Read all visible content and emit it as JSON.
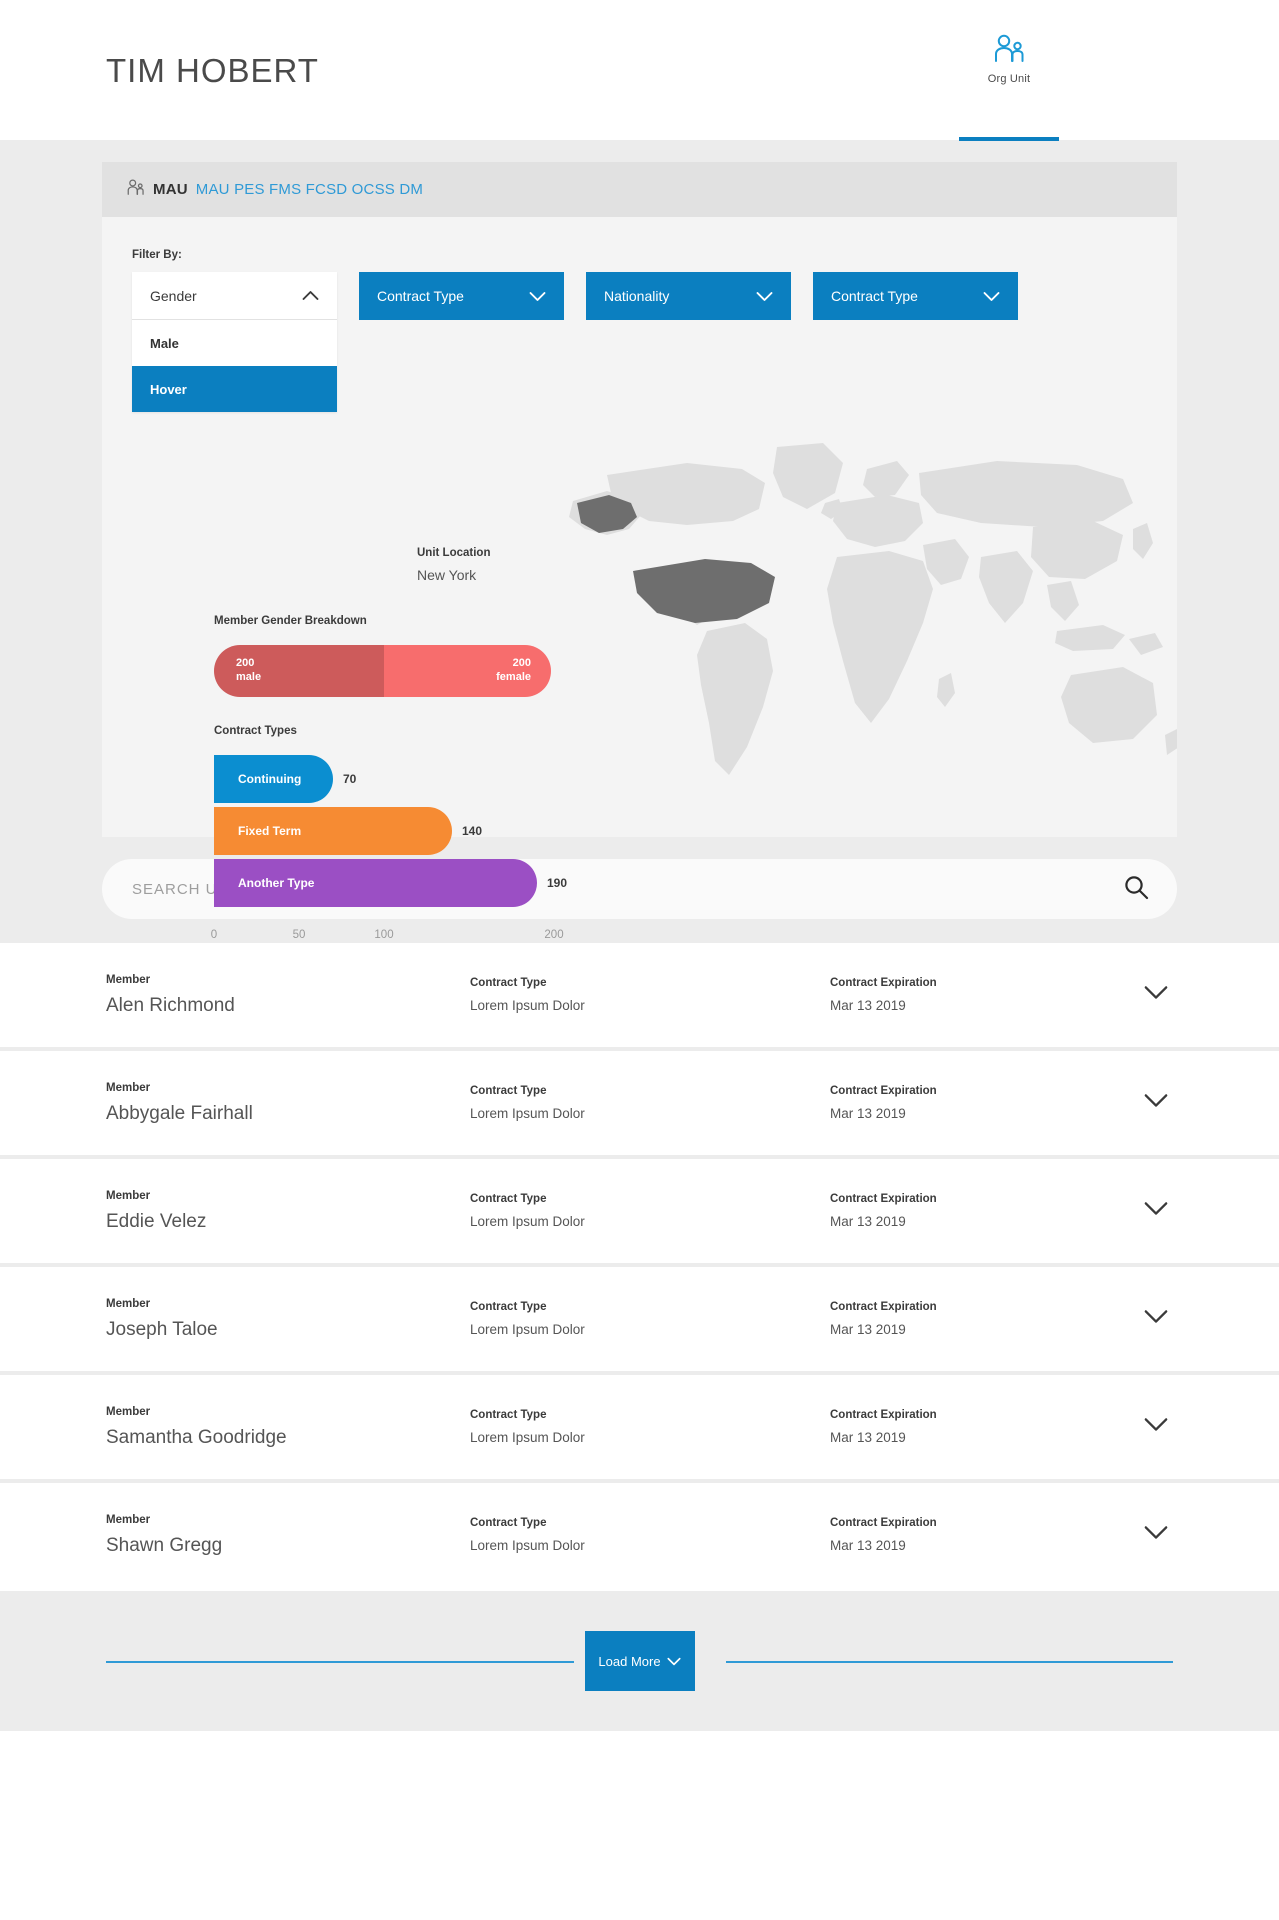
{
  "header": {
    "title": "TIM HOBERT",
    "tab": {
      "label": "Org Unit",
      "icon": "people-icon"
    }
  },
  "breadcrumb": {
    "icon": "people-icon",
    "root": "MAU",
    "path": "MAU PES FMS FCSD OCSS DM"
  },
  "filters": {
    "label": "Filter By:",
    "gender_dropdown": {
      "name": "Gender",
      "state": "open",
      "chevron": "chevron-up-icon",
      "options": [
        {
          "label": "Male",
          "hovered": false
        },
        {
          "label": "Hover",
          "hovered": true
        }
      ]
    },
    "dropdowns": [
      {
        "label": "Contract Type",
        "chevron": "chevron-down-icon"
      },
      {
        "label": "Nationality",
        "chevron": "chevron-down-icon"
      },
      {
        "label": "Contract Type",
        "chevron": "chevron-down-icon"
      }
    ]
  },
  "unit_location": {
    "label": "Unit Location",
    "value": "New York"
  },
  "gender_breakdown": {
    "title": "Member Gender Breakdown",
    "segments": [
      {
        "count": "200",
        "label": "male",
        "color": "#cd5b5b"
      },
      {
        "count": "200",
        "label": "female",
        "color": "#f76d6d"
      }
    ]
  },
  "contract_types": {
    "title": "Contract Types"
  },
  "chart_data": {
    "type": "bar",
    "orientation": "horizontal",
    "title": "Contract Types",
    "categories": [
      "Continuing",
      "Fixed Term",
      "Another Type"
    ],
    "values": [
      70,
      140,
      190
    ],
    "colors": [
      "#0b8ed0",
      "#f68b33",
      "#9b4fc4"
    ],
    "xlabel": "",
    "ylabel": "",
    "xlim": [
      0,
      200
    ],
    "ticks": [
      "0",
      "50",
      "100",
      "200"
    ],
    "grid": false,
    "legend": false
  },
  "map": {
    "name": "world-map",
    "highlighted_country": "United States",
    "base_color": "#dedede",
    "highlight_color": "#6e6e6e"
  },
  "search": {
    "placeholder": "SEARCH UNIT MEMBERS",
    "value": "",
    "icon": "search-icon"
  },
  "members_table": {
    "columns": {
      "member": "Member",
      "contract_type": "Contract Type",
      "contract_expiration": "Contract Expiration"
    },
    "rows": [
      {
        "member": "Alen Richmond",
        "contract_type": "Lorem Ipsum Dolor",
        "contract_expiration": "Mar 13 2019"
      },
      {
        "member": "Abbygale Fairhall",
        "contract_type": "Lorem Ipsum Dolor",
        "contract_expiration": "Mar 13 2019"
      },
      {
        "member": "Eddie Velez",
        "contract_type": "Lorem Ipsum Dolor",
        "contract_expiration": "Mar 13 2019"
      },
      {
        "member": "Joseph Taloe",
        "contract_type": "Lorem Ipsum Dolor",
        "contract_expiration": "Mar 13 2019"
      },
      {
        "member": "Samantha Goodridge",
        "contract_type": "Lorem Ipsum Dolor",
        "contract_expiration": "Mar 13 2019"
      },
      {
        "member": "Shawn Gregg",
        "contract_type": "Lorem Ipsum Dolor",
        "contract_expiration": "Mar 13 2019"
      }
    ]
  },
  "footer": {
    "load_more": "Load More",
    "chevron": "chevron-down-icon"
  },
  "colors": {
    "accent": "#0b7fc0",
    "link": "#2f9ad6",
    "canvas": "#ececec",
    "panel": "#f4f4f4"
  }
}
